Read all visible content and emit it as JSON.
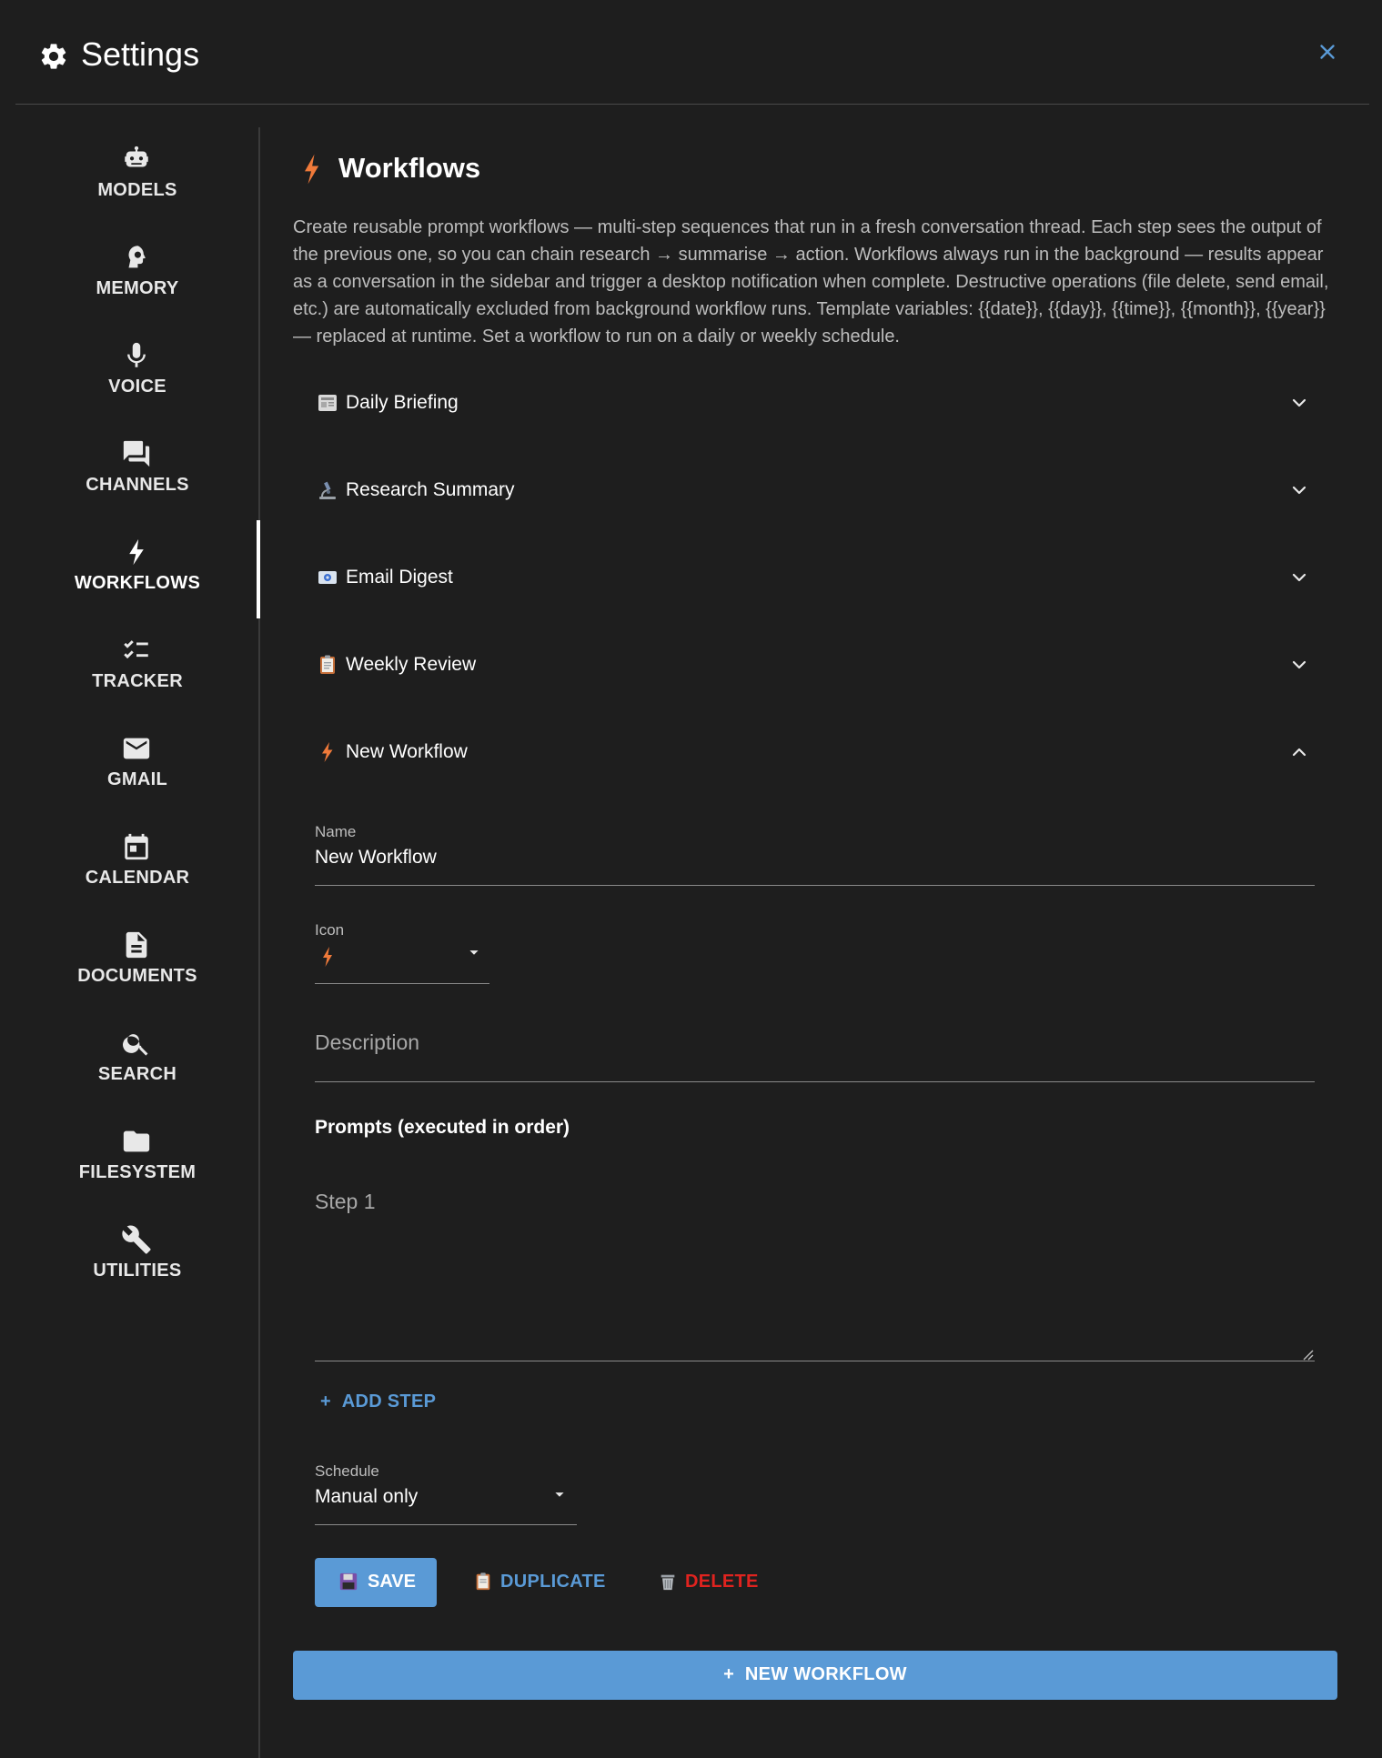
{
  "header": {
    "title": "Settings",
    "gear_icon": "gear-icon",
    "close_icon": "close-icon"
  },
  "sidebar": {
    "items": [
      {
        "label": "MODELS",
        "icon": "robot-icon"
      },
      {
        "label": "MEMORY",
        "icon": "brain-head-icon"
      },
      {
        "label": "VOICE",
        "icon": "microphone-icon"
      },
      {
        "label": "CHANNELS",
        "icon": "chat-bubbles-icon"
      },
      {
        "label": "WORKFLOWS",
        "icon": "bolt-icon",
        "active": true
      },
      {
        "label": "TRACKER",
        "icon": "checklist-icon"
      },
      {
        "label": "GMAIL",
        "icon": "envelope-icon"
      },
      {
        "label": "CALENDAR",
        "icon": "calendar-icon"
      },
      {
        "label": "DOCUMENTS",
        "icon": "document-icon"
      },
      {
        "label": "SEARCH",
        "icon": "search-icon"
      },
      {
        "label": "FILESYSTEM",
        "icon": "folder-icon"
      },
      {
        "label": "UTILITIES",
        "icon": "wrench-icon"
      }
    ]
  },
  "main": {
    "title": "Workflows",
    "description": "Create reusable prompt workflows — multi-step sequences that run in a fresh conversation thread. Each step sees the output of the previous one, so you can chain research → summarise → action. Workflows always run in the background — results appear as a conversation in the sidebar and trigger a desktop notification when complete. Destructive operations (file delete, send email, etc.) are automatically excluded from background workflow runs. Template variables: {{date}}, {{day}}, {{time}}, {{month}}, {{year}} — replaced at runtime. Set a workflow to run on a daily or weekly schedule.",
    "workflows": [
      {
        "name": "Daily Briefing",
        "icon": "newspaper-icon",
        "expanded": false
      },
      {
        "name": "Research Summary",
        "icon": "microscope-icon",
        "expanded": false
      },
      {
        "name": "Email Digest",
        "icon": "email-icon",
        "expanded": false
      },
      {
        "name": "Weekly Review",
        "icon": "clipboard-icon",
        "expanded": false
      },
      {
        "name": "New Workflow",
        "icon": "bolt-icon",
        "expanded": true
      }
    ],
    "editor": {
      "name_label": "Name",
      "name_value": "New Workflow",
      "icon_label": "Icon",
      "icon_value": "bolt-icon",
      "description_placeholder": "Description",
      "prompts_heading": "Prompts (executed in order)",
      "step_placeholder": "Step 1",
      "add_step": "ADD STEP",
      "schedule_label": "Schedule",
      "schedule_value": "Manual only",
      "save": "SAVE",
      "duplicate": "DUPLICATE",
      "delete": "DELETE"
    },
    "new_workflow": "NEW WORKFLOW"
  },
  "colors": {
    "background": "#1e1e1e",
    "accent": "#5a9ad6",
    "danger": "#e0231f",
    "bolt": "#f07a3a",
    "text_muted": "#bdbdbd"
  }
}
